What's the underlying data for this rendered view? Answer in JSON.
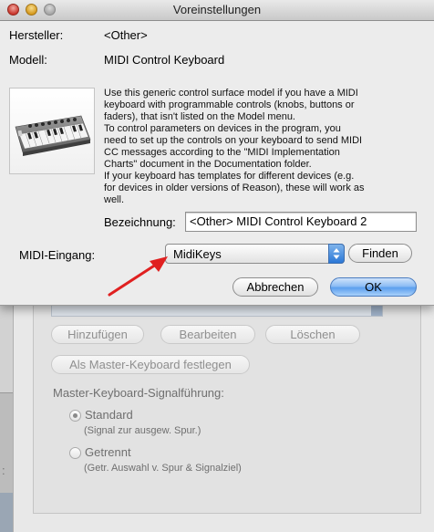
{
  "dialog": {
    "title": "Voreinstellungen",
    "manufacturer_label": "Hersteller:",
    "manufacturer_value": "<Other>",
    "model_label": "Modell:",
    "model_value": "MIDI Control Keyboard",
    "description_lines": [
      "Use this generic control surface model if you have a MIDI",
      "keyboard with programmable controls (knobs, buttons or",
      "faders), that isn't listed on the Model menu.",
      "To control parameters on devices in the program, you",
      "need to set up the controls on your keyboard to send MIDI",
      "CC messages according to the \"MIDI Implementation",
      "Charts\" document in the Documentation folder.",
      "If your keyboard has templates for different devices (e.g.",
      "for devices in older versions of Reason), these will work as",
      "well."
    ],
    "name_label": "Bezeichnung:",
    "name_value": "<Other> MIDI Control Keyboard 2",
    "midi_input_label": "MIDI-Eingang:",
    "midi_input_value": "MidiKeys",
    "find_button": "Finden",
    "cancel_button": "Abbrechen",
    "ok_button": "OK"
  },
  "background": {
    "buttons": {
      "add": "Hinzufügen",
      "edit": "Bearbeiten",
      "delete": "Löschen",
      "set_master": "Als Master-Keyboard festlegen"
    },
    "routing_title": "Master-Keyboard-Signalführung:",
    "radio_standard": "Standard",
    "radio_standard_desc": "(Signal zur ausgew. Spur.)",
    "radio_separate": "Getrennt",
    "radio_separate_desc": "(Getr. Auswahl v. Spur & Signalziel)",
    "left_colon": ":"
  },
  "colors": {
    "annotation_arrow": "#e02020",
    "default_button": "#5c9fee"
  }
}
